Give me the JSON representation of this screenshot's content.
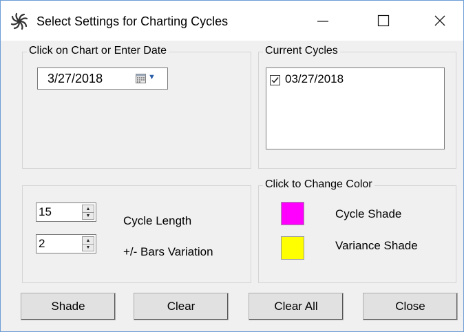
{
  "window": {
    "title": "Select Settings for Charting Cycles",
    "controls": {
      "minimize": "—",
      "maximize": "☐",
      "close": "✕"
    }
  },
  "date_group": {
    "label": "Click on Chart or Enter Date",
    "date_value": "3/27/2018",
    "calendar_icon": "calendar-icon"
  },
  "cycles_group": {
    "label": "Current Cycles",
    "items": [
      {
        "checked": true,
        "label": "03/27/2018"
      }
    ]
  },
  "settings_group": {
    "cycle_length": {
      "value": "15",
      "label": "Cycle Length"
    },
    "bars_variation": {
      "value": "2",
      "label": "+/- Bars Variation"
    }
  },
  "color_group": {
    "label": "Click to Change Color",
    "cycle_shade": {
      "label": "Cycle Shade",
      "color": "#ff00ff"
    },
    "variance_shade": {
      "label": "Variance Shade",
      "color": "#ffff00"
    }
  },
  "buttons": {
    "shade": "Shade",
    "clear": "Clear",
    "clear_all": "Clear All",
    "close": "Close"
  }
}
